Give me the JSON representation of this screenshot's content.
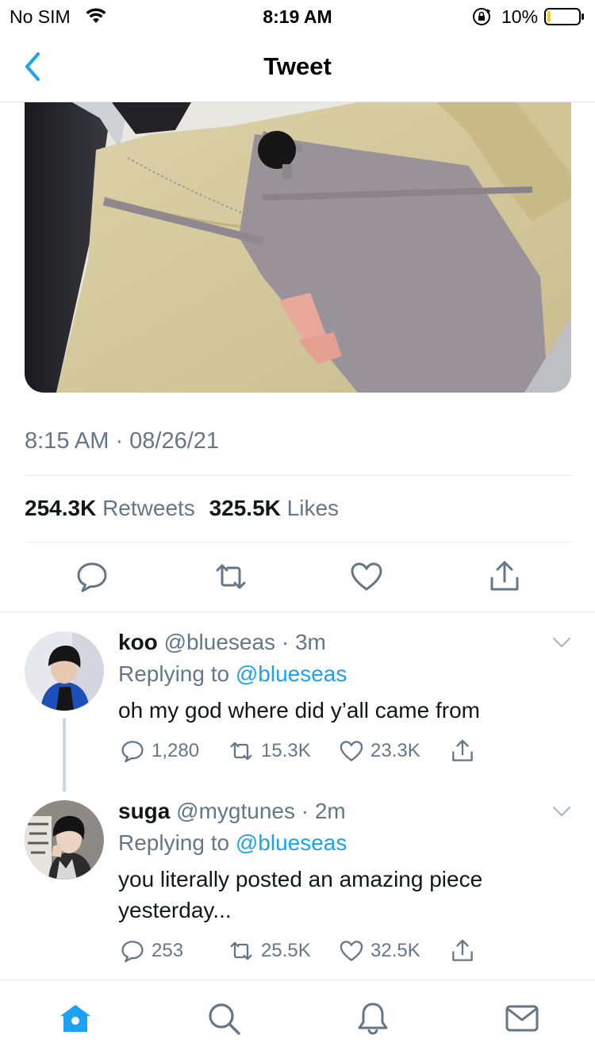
{
  "status_bar": {
    "carrier": "No SIM",
    "time": "8:19 AM",
    "battery_percent": "10%",
    "battery_level": 0.1
  },
  "nav": {
    "title": "Tweet",
    "back_icon": "chevron-left-icon"
  },
  "tweet": {
    "timestamp": "8:15 AM · 08/26/21",
    "retweets_count": "254.3K",
    "retweets_label": "Retweets",
    "likes_count": "325.5K",
    "likes_label": "Likes",
    "actions": [
      "reply-icon",
      "retweet-icon",
      "like-icon",
      "share-icon"
    ]
  },
  "replies": [
    {
      "name": "koo",
      "handle": "@blueseas",
      "time": "· 3m",
      "replying_prefix": "Replying to",
      "replying_handle": "@blueseas",
      "text": "oh my god where did y’all came from",
      "reply_count": "1,280",
      "retweet_count": "15.3K",
      "like_count": "23.3K"
    },
    {
      "name": "suga",
      "handle": "@mygtunes",
      "time": "· 2m",
      "replying_prefix": "Replying to",
      "replying_handle": "@blueseas",
      "text": "you literally posted an amazing piece yesterday...",
      "reply_count": "253",
      "retweet_count": "25.5K",
      "like_count": "32.5K"
    }
  ],
  "tab_bar": [
    "home-icon",
    "search-icon",
    "notifications-icon",
    "messages-icon"
  ],
  "colors": {
    "accent": "#1da1f2",
    "secondary_text": "#657786",
    "divider": "#e1e8ed"
  }
}
